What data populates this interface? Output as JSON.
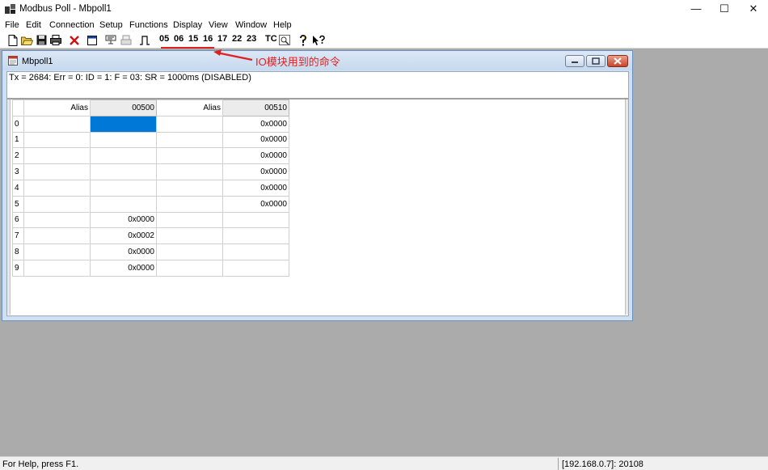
{
  "window": {
    "title": "Modbus Poll - Mbpoll1",
    "minimize": "—",
    "maximize": "☐",
    "close": "✕"
  },
  "menu": [
    "File",
    "Edit",
    "Connection",
    "Setup",
    "Functions",
    "Display",
    "View",
    "Window",
    "Help"
  ],
  "toolbar": {
    "function_codes": [
      "05",
      "06",
      "15",
      "16",
      "17",
      "22",
      "23"
    ],
    "tc_label": "TC"
  },
  "annotation": {
    "text": "IO模块用到的命令",
    "color": "#e02020"
  },
  "child_window": {
    "title": "Mbpoll1",
    "status": "Tx = 2684: Err = 0: ID = 1: F = 03: SR = 1000ms  (DISABLED)"
  },
  "grid": {
    "columns": [
      "Alias",
      "00500",
      "Alias",
      "00510"
    ],
    "rows": [
      {
        "idx": "0",
        "a1": "",
        "v1": "",
        "a2": "",
        "v2": "0x0000"
      },
      {
        "idx": "1",
        "a1": "",
        "v1": "",
        "a2": "",
        "v2": "0x0000"
      },
      {
        "idx": "2",
        "a1": "",
        "v1": "",
        "a2": "",
        "v2": "0x0000"
      },
      {
        "idx": "3",
        "a1": "",
        "v1": "",
        "a2": "",
        "v2": "0x0000"
      },
      {
        "idx": "4",
        "a1": "",
        "v1": "",
        "a2": "",
        "v2": "0x0000"
      },
      {
        "idx": "5",
        "a1": "",
        "v1": "",
        "a2": "",
        "v2": "0x0000"
      },
      {
        "idx": "6",
        "a1": "",
        "v1": "0x0000",
        "a2": "",
        "v2": ""
      },
      {
        "idx": "7",
        "a1": "",
        "v1": "0x0002",
        "a2": "",
        "v2": ""
      },
      {
        "idx": "8",
        "a1": "",
        "v1": "0x0000",
        "a2": "",
        "v2": ""
      },
      {
        "idx": "9",
        "a1": "",
        "v1": "0x0000",
        "a2": "",
        "v2": ""
      }
    ],
    "selection_color": "#0078d7"
  },
  "statusbar": {
    "help": "For Help, press F1.",
    "address": "[192.168.0.7]: 20108"
  },
  "colors": {
    "workspace": "#ababab",
    "child_frame": "#cfe0f2"
  }
}
